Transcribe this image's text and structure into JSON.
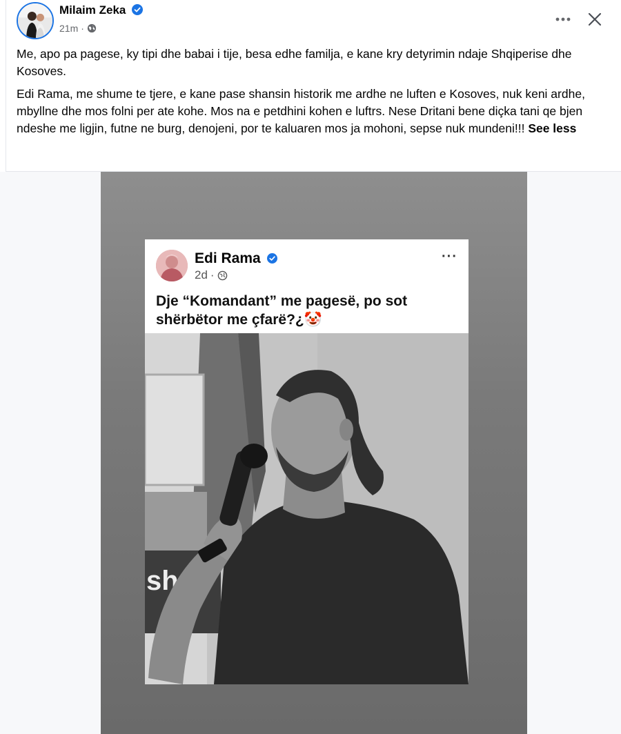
{
  "post": {
    "author": "Milaim Zeka",
    "time": "21m",
    "separator": "·",
    "privacy_icon": "globe-icon",
    "paragraphs": [
      "Me, apo pa pagese, ky tipi dhe babai i tije, besa edhe familja, e kane kry detyrimin ndaje Shqiperise dhe Kosoves.",
      "Edi Rama, me shume te tjere, e kane pase shansin historik me ardhe ne luften e Kosoves, nuk keni ardhe, mbyllne dhe mos folni per ate kohe. Mos na e petdhini kohen e luftrs. Nese Dritani bene diçka tani qe bjen ndeshe me ligjin, futne ne burg, denojeni, por te kaluaren mos ja mohoni, sepse nuk mundeni!!!"
    ],
    "see_less": "See less"
  },
  "embedded": {
    "author": "Edi Rama",
    "time": "2d",
    "separator": "·",
    "text": "Dje “Komandant” me pagesë, po sot shërbëtor me çfarë?¿🤡",
    "more": "···"
  },
  "photo_caption_fragment": "sha",
  "colors": {
    "verified": "#1b74e4",
    "secondary_text": "#65676b",
    "primary_text": "#050505"
  },
  "icons": [
    "verified-badge-icon",
    "globe-icon",
    "more-options-icon",
    "close-icon"
  ]
}
